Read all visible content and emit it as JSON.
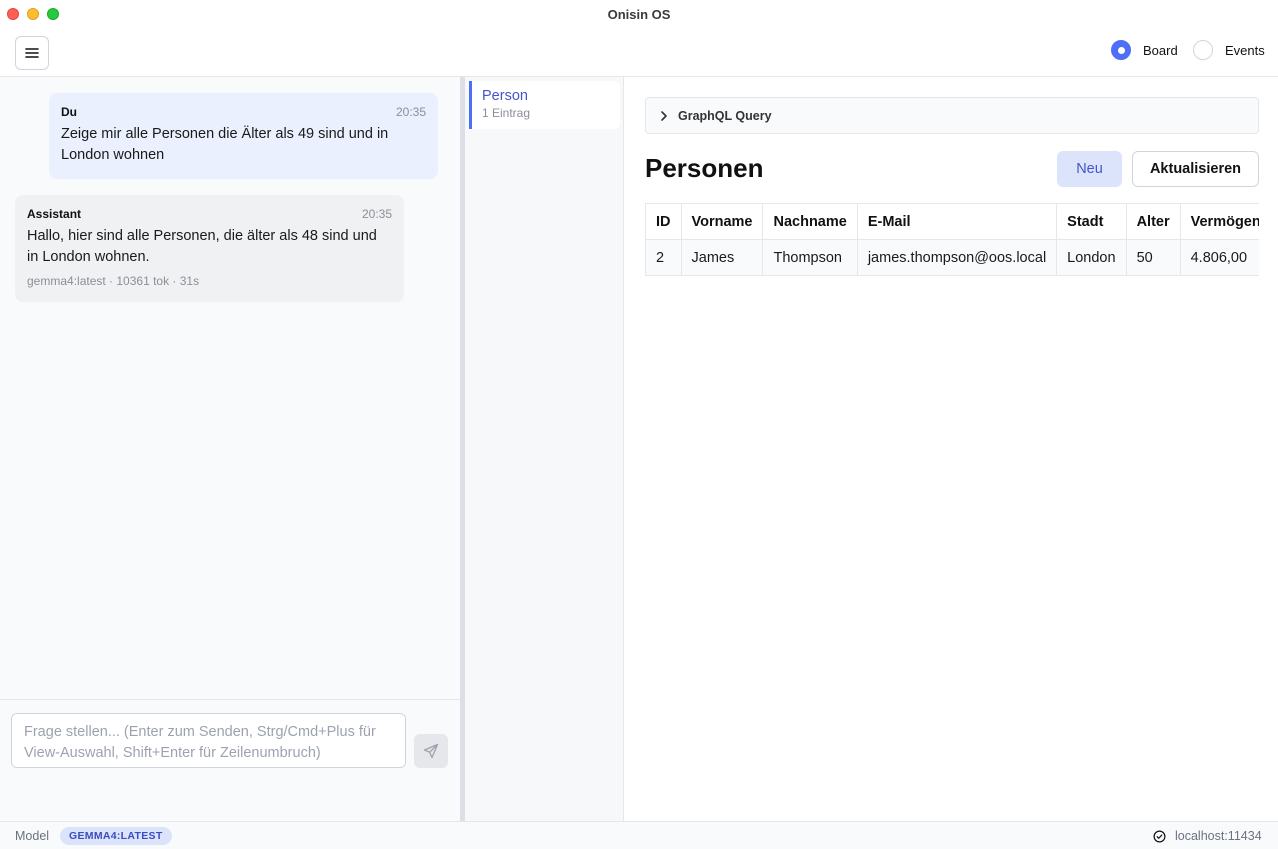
{
  "window": {
    "title": "Onisin OS"
  },
  "topbar": {
    "views": [
      {
        "label": "Board",
        "selected": true
      },
      {
        "label": "Events",
        "selected": false
      }
    ]
  },
  "chat": {
    "messages": [
      {
        "author": "Du",
        "time": "20:35",
        "text": "Zeige mir alle Personen die Älter als 49 sind und in London wohnen"
      },
      {
        "author": "Assistant",
        "time": "20:35",
        "text": "Hallo, hier sind alle Personen, die älter als 48 sind und in London wohnen.",
        "meta": "gemma4:latest · 10361 tok · 31s"
      }
    ],
    "input_placeholder": "Frage stellen... (Enter zum Senden, Strg/Cmd+Plus für View-Auswahl, Shift+Enter für Zeilenumbruch)",
    "input_value": ""
  },
  "entities": [
    {
      "name": "Person",
      "count": "1 Eintrag"
    }
  ],
  "main": {
    "graphql_label": "GraphQL Query",
    "title": "Personen",
    "new_label": "Neu",
    "refresh_label": "Aktualisieren",
    "table": {
      "columns": [
        "ID",
        "Vorname",
        "Nachname",
        "E-Mail",
        "Stadt",
        "Alter",
        "Vermögen"
      ],
      "rows": [
        [
          "2",
          "James",
          "Thompson",
          "james.thompson@oos.local",
          "London",
          "50",
          "4.806,00"
        ]
      ]
    }
  },
  "statusbar": {
    "model_label": "Model",
    "model_value": "GEMMA4:LATEST",
    "connection": "localhost:11434"
  },
  "colors": {
    "accent": "#4f6ef7",
    "user_bubble": "#eaf0fd",
    "assistant_bubble": "#f0f1f3"
  }
}
